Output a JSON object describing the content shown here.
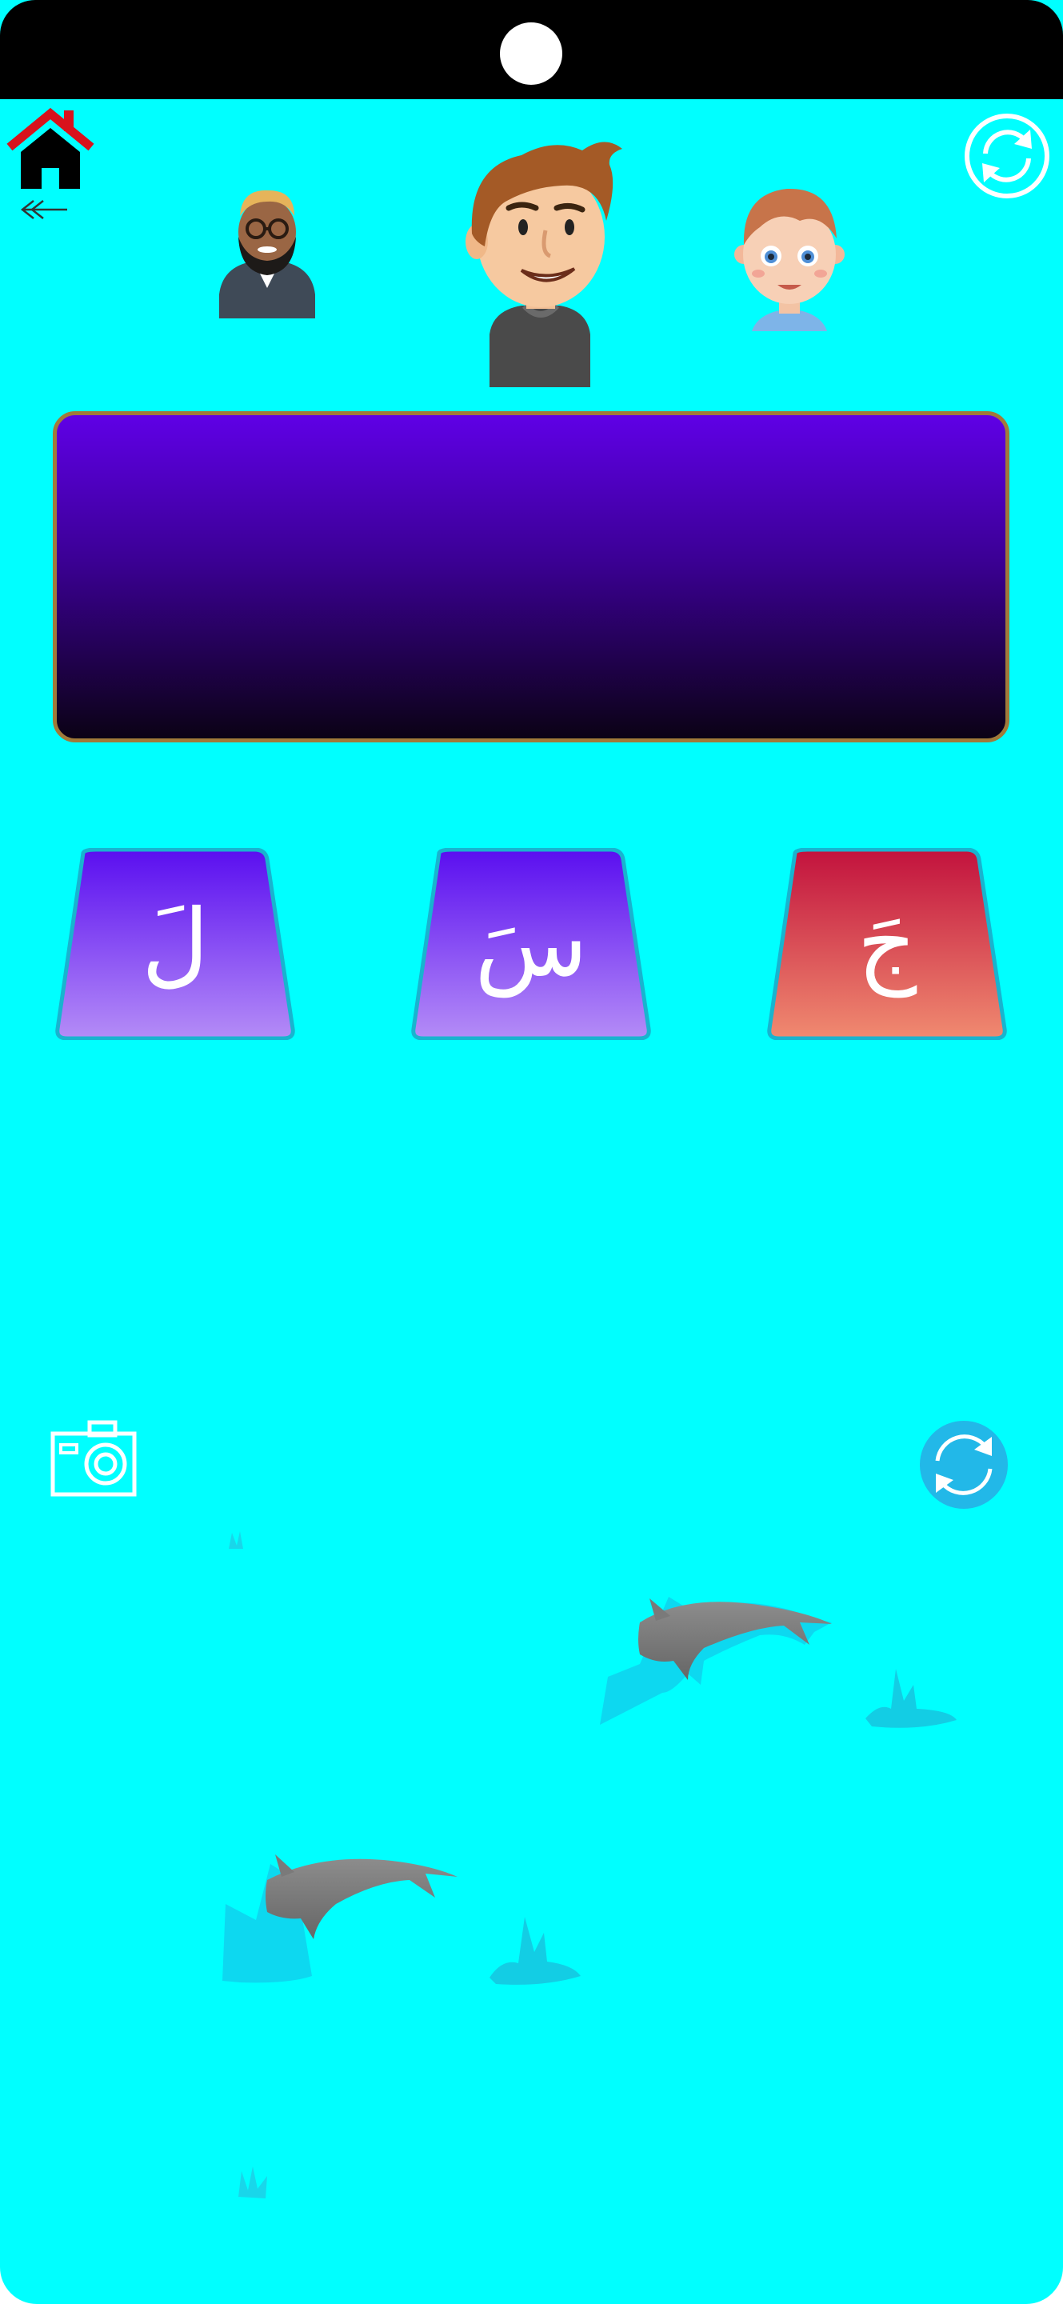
{
  "app": {
    "background_color": "#00ffff",
    "status_bar_color": "#000000"
  },
  "nav": {
    "home_icon": "home-icon",
    "back_icon": "arrow-left-icon",
    "refresh_icon": "refresh-circle-icon"
  },
  "characters": [
    {
      "name": "bearded-man-avatar"
    },
    {
      "name": "young-man-avatar",
      "selected": true
    },
    {
      "name": "child-avatar"
    }
  ],
  "answer_panel": {
    "text": "",
    "gradient": [
      "#5f00e6",
      "#0b0215"
    ],
    "border_color": "#a07a3a"
  },
  "choices": [
    {
      "letter": "لَ",
      "colors": [
        "#5a0ef0",
        "#b48cf7"
      ]
    },
    {
      "letter": "سَ",
      "colors": [
        "#5a0ef0",
        "#b48cf7"
      ]
    },
    {
      "letter": "جَ",
      "colors": [
        "#c2123d",
        "#f08a70"
      ]
    }
  ],
  "tools": {
    "camera_icon": "camera-icon",
    "switch_icon": "switch-camera-icon"
  },
  "decor": {
    "dolphin_icon": "dolphin-icon",
    "splash_icon": "water-splash-icon"
  }
}
